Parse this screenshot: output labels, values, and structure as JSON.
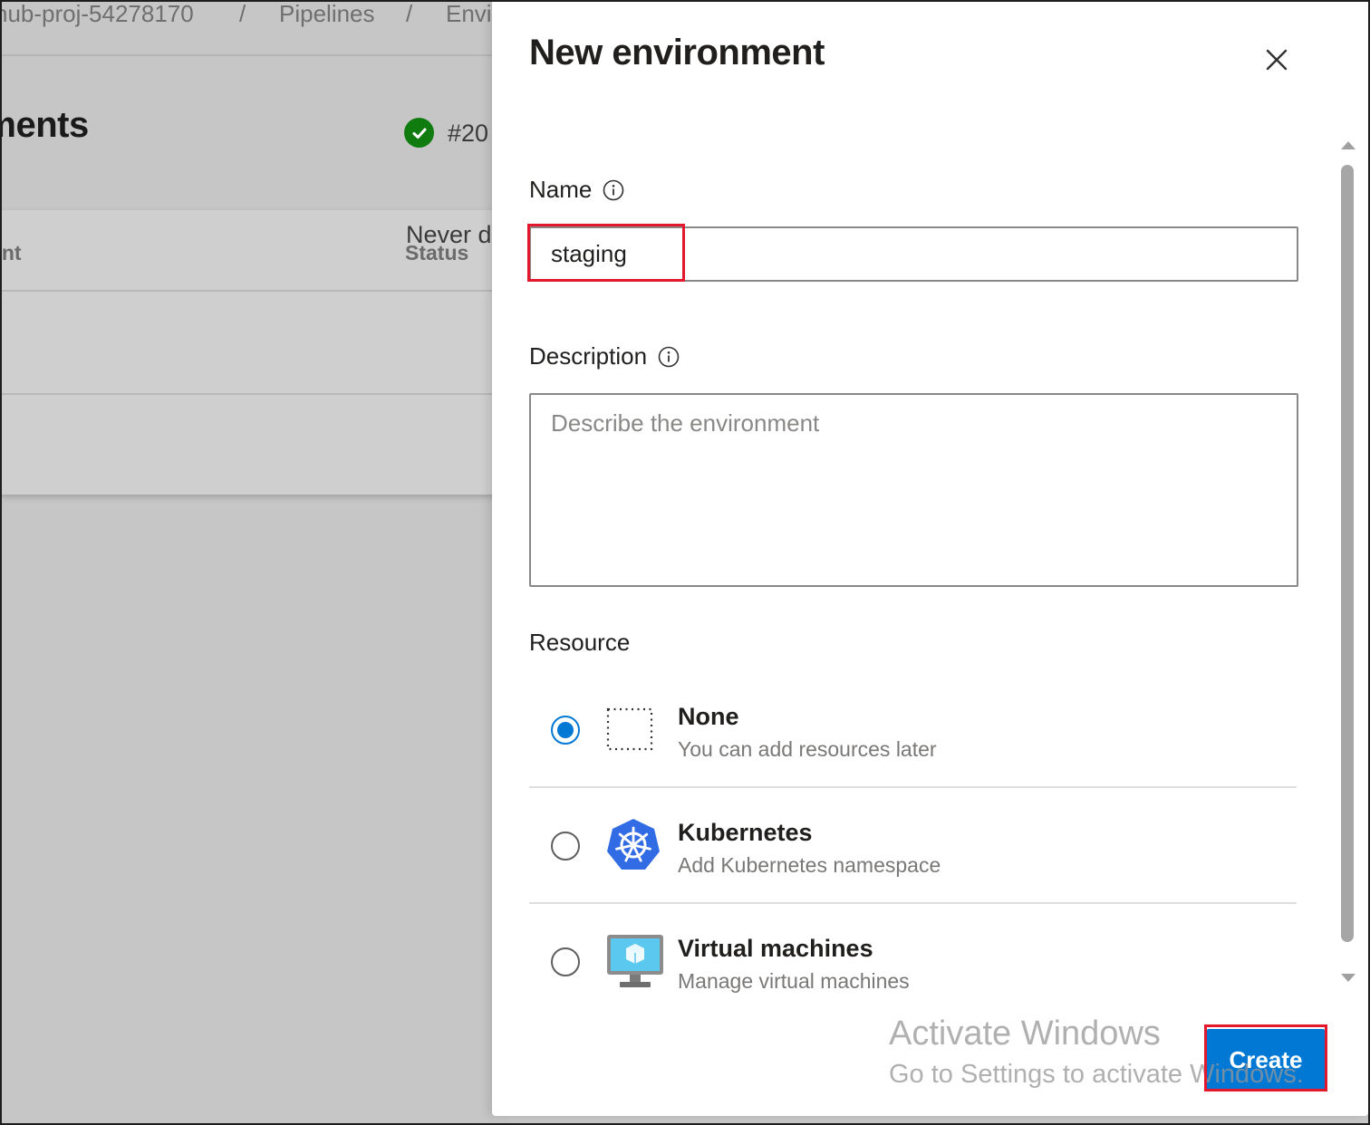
{
  "background": {
    "breadcrumb": [
      "hub-proj-54278170",
      "/",
      "Pipelines",
      "/",
      "Envi"
    ],
    "page_title": "Environments",
    "table": {
      "columns": [
        "Environment",
        "Status"
      ],
      "rows": [
        {
          "status": "#20",
          "status_icon": "success-check-icon"
        },
        {
          "status": "Never d"
        }
      ]
    }
  },
  "panel": {
    "title": "New environment",
    "name": {
      "label": "Name",
      "value": "staging"
    },
    "description": {
      "label": "Description",
      "placeholder": "Describe the environment",
      "value": ""
    },
    "resource": {
      "label": "Resource",
      "options": [
        {
          "id": "none",
          "title": "None",
          "subtitle": "You can add resources later",
          "icon": "dotted-square-icon",
          "selected": true
        },
        {
          "id": "kubernetes",
          "title": "Kubernetes",
          "subtitle": "Add Kubernetes namespace",
          "icon": "kubernetes-icon",
          "selected": false
        },
        {
          "id": "virtual-machines",
          "title": "Virtual machines",
          "subtitle": "Manage virtual machines",
          "icon": "virtual-machine-icon",
          "selected": false
        }
      ]
    },
    "create_label": "Create"
  },
  "watermark": {
    "line1": "Activate Windows",
    "line2": "Go to Settings to activate Windows."
  },
  "colors": {
    "primary": "#0078d4",
    "highlight": "#e3182d",
    "success": "#107c10",
    "kubernetes": "#326ce5"
  }
}
